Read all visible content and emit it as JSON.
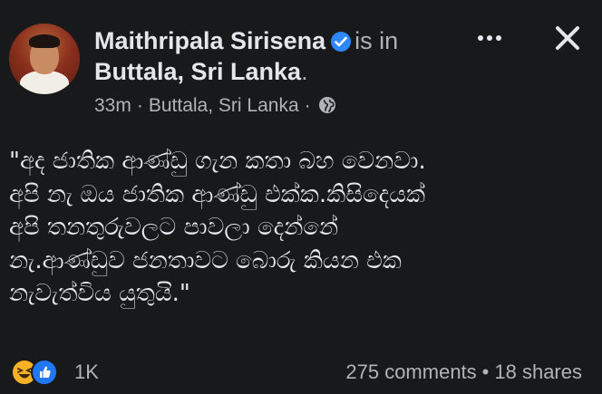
{
  "header": {
    "author": "Maithripala Sirisena",
    "is_in": "is in",
    "location": "Buttala, Sri Lanka",
    "period": ".",
    "time": "33m",
    "meta_location": "Buttala, Sri Lanka",
    "separator": "·",
    "verified_icon": "verified-badge",
    "privacy_icon": "globe-icon",
    "more_icon": "more-horizontal-icon",
    "close_icon": "close-icon"
  },
  "post": {
    "lines": [
      "\"අද ජාතික ආණ්ඩු ගැන කතා බහ වෙනවා.",
      "අපි නැ ඔය ජාතික ආණ්ඩු එක්ක.කිසිදෙයක්",
      "අපි තනතුරුවලට පාවලා දෙන්නේ",
      "නැ.ආණ්ඩුව ජනතාවට බොරු කියන එක",
      "නැවැත්විය යුතුයි.\""
    ]
  },
  "footer": {
    "reaction_icons": [
      "haha-icon",
      "like-icon"
    ],
    "reaction_count": "1K",
    "comments": "275 comments",
    "separator": "•",
    "shares": "18 shares"
  },
  "colors": {
    "background": "#18191a",
    "primary_text": "#e4e6eb",
    "secondary_text": "#b0b3b8",
    "verified_blue": "#2d88ff",
    "like_blue": "#2078f4",
    "haha_yellow": "#f7b125"
  }
}
